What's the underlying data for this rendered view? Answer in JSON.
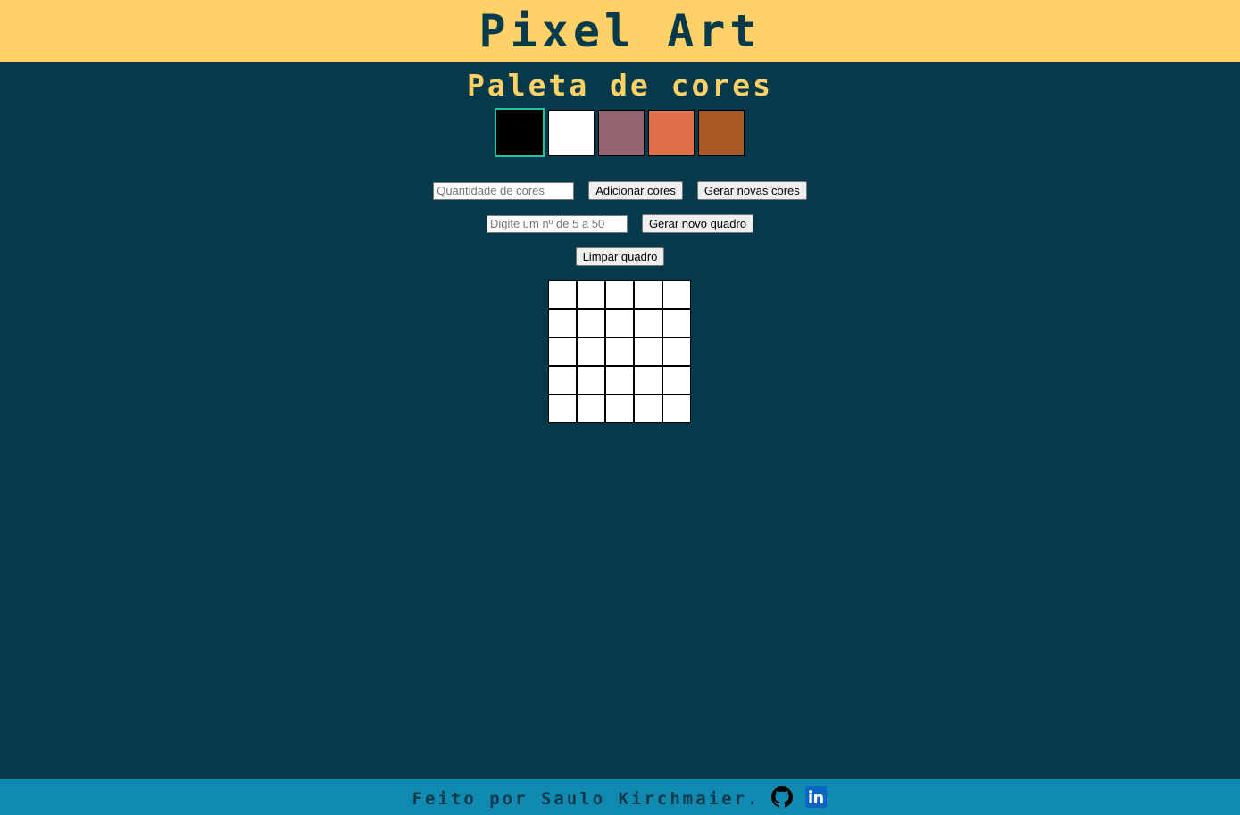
{
  "header": {
    "title": "Pixel Art"
  },
  "palette": {
    "title": "Paleta de cores",
    "colors": [
      "#000000",
      "#ffffff",
      "#946370",
      "#e0704a",
      "#a85822"
    ],
    "selected_index": 0,
    "selected_border_color": "#1bc6a0"
  },
  "controls": {
    "color_count_input": {
      "placeholder": "Quantidade de cores",
      "value": ""
    },
    "add_colors_label": "Adicionar cores",
    "new_colors_label": "Gerar novas cores",
    "board_size_input": {
      "placeholder": "Digite um nº de 5 a 50",
      "value": ""
    },
    "new_board_label": "Gerar novo quadro",
    "clear_board_label": "Limpar quadro"
  },
  "board": {
    "size": 5,
    "pixel_color": "#ffffff"
  },
  "footer": {
    "credit": "Feito por Saulo Kirchmaier.",
    "links": [
      {
        "icon": "github-icon"
      },
      {
        "icon": "linkedin-icon"
      }
    ]
  },
  "theme": {
    "header_bg": "#ffd166",
    "page_bg": "#063a4b",
    "footer_bg": "#118ab2",
    "accent_text": "#ffd166",
    "dark_text": "#073b4c"
  }
}
